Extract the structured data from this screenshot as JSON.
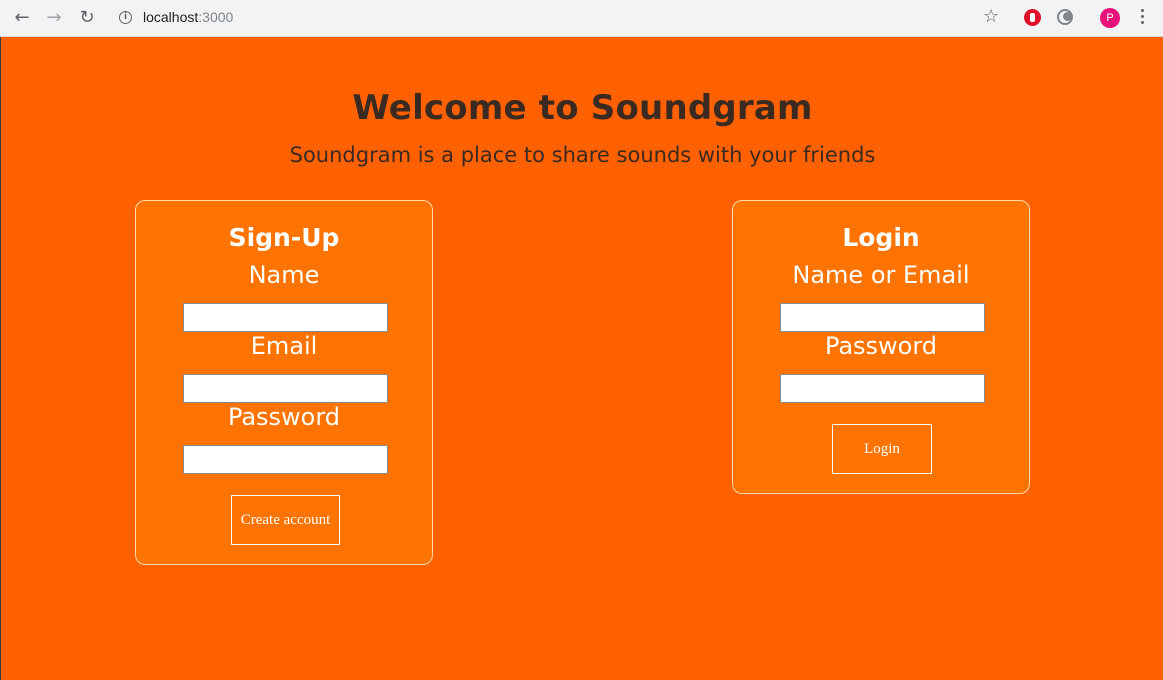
{
  "browser": {
    "url_host": "localhost",
    "url_port": ":3000",
    "profile_initial": "P",
    "icons": {
      "back": "back-arrow-icon",
      "forward": "forward-arrow-icon",
      "reload": "reload-icon",
      "info": "info-icon",
      "bookmark": "star-icon",
      "menu": "kebab-menu-icon"
    }
  },
  "header": {
    "title": "Welcome to Soundgram",
    "subtitle": "Soundgram is a place to share sounds with your friends"
  },
  "signup": {
    "title": "Sign-Up",
    "name_label": "Name",
    "name_value": "",
    "email_label": "Email",
    "email_value": "",
    "password_label": "Password",
    "password_value": "",
    "submit_label": "Create account"
  },
  "login": {
    "title": "Login",
    "identifier_label": "Name or Email",
    "identifier_value": "",
    "password_label": "Password",
    "password_value": "",
    "submit_label": "Login"
  },
  "colors": {
    "page_background": "#ff6100",
    "card_background": "#ff7300",
    "heading_text": "#3b2a22",
    "card_text": "#ffffff"
  }
}
